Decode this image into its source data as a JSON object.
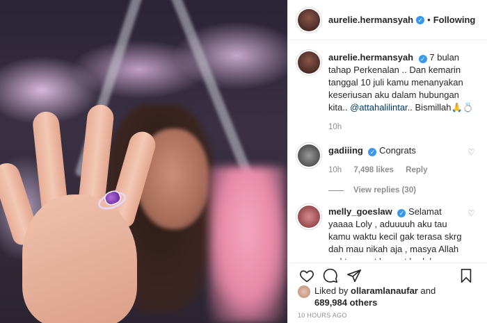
{
  "post": {
    "username": "aurelie.hermansyah",
    "follow_status": "Following",
    "caption_text": "7 bulan tahap Perkenalan .. Dan kemarin tanggal 10 juli kamu menanyakan keseriusan aku dalam hubungan kita..",
    "caption_mention": "@attahalilintar",
    "caption_tail": ".. Bismillah🙏💍",
    "caption_time": "10h",
    "likes_by": "ollaramlanaufar",
    "likes_text_and": "and",
    "likes_others": "689,984 others",
    "liked_by_label": "Liked by",
    "timestamp": "10 HOURS AGO"
  },
  "comments": [
    {
      "username": "gadiiing",
      "text": "Congrats",
      "time": "10h",
      "likes": "7,498 likes",
      "reply_label": "Reply",
      "view_replies": "View replies (30)"
    },
    {
      "username": "melly_goeslaw",
      "text": "Selamat yaaaa Loly , aduuuuh aku tau kamu waktu kecil gak terasa skrg dah mau nikah aja , masya Allah waktu cepet banget berlalu"
    }
  ],
  "icons": [
    "heart-icon",
    "comment-icon",
    "share-icon",
    "bookmark-icon",
    "verified-icon"
  ],
  "colors": {
    "verified": "#3897f0",
    "mention": "#00376b",
    "meta": "#8e8e8e"
  }
}
